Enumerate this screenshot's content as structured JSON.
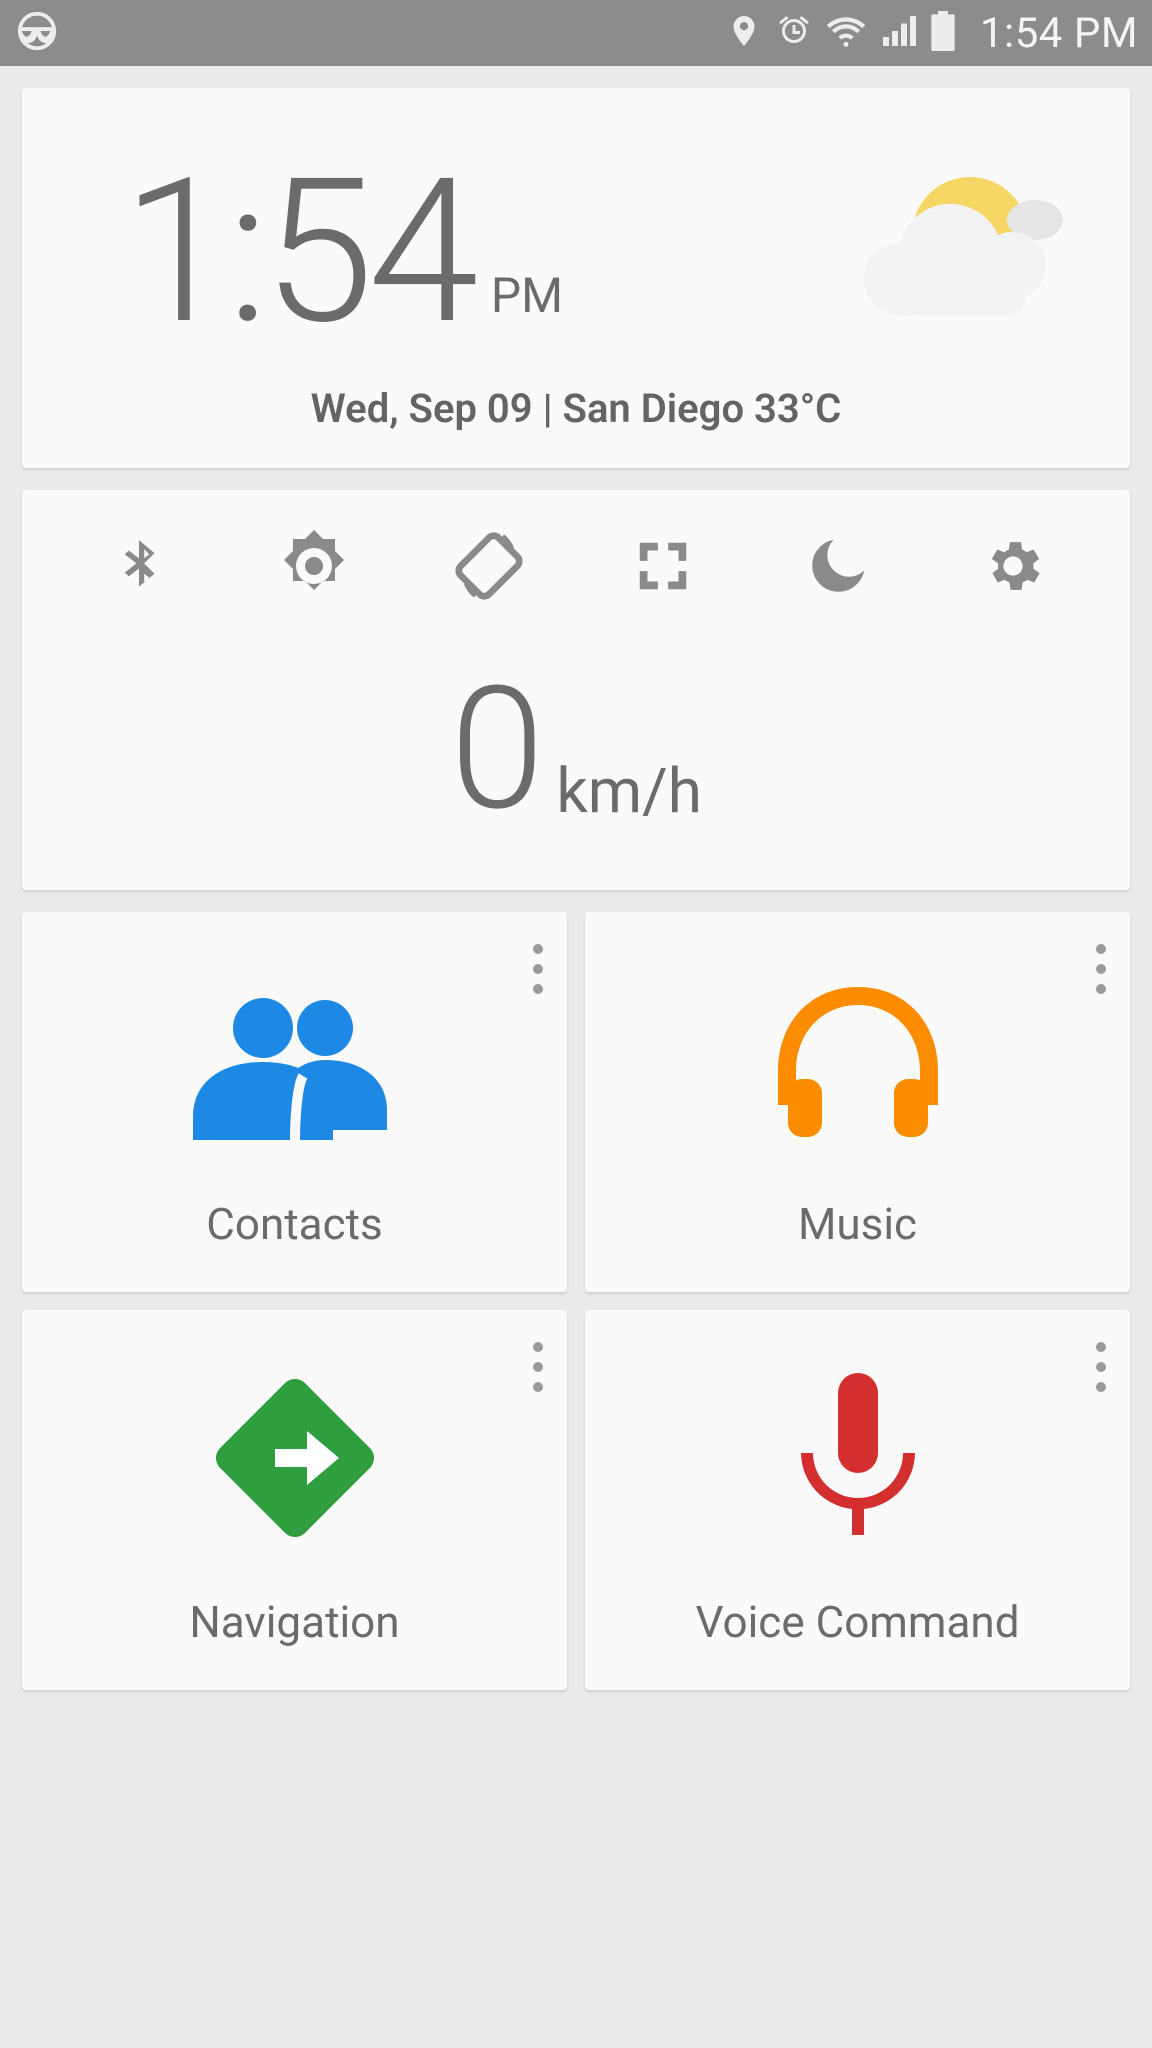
{
  "status_bar": {
    "time": "1:54 PM"
  },
  "clock": {
    "time": "1:54",
    "ampm": "PM",
    "date_line": "Wed, Sep 09 | San Diego 33°C"
  },
  "speed": {
    "value": "0",
    "unit": "km/h"
  },
  "toggles": [
    {
      "name": "bluetooth-icon"
    },
    {
      "name": "brightness-icon"
    },
    {
      "name": "rotate-icon"
    },
    {
      "name": "fullscreen-icon"
    },
    {
      "name": "night-icon"
    },
    {
      "name": "settings-icon"
    }
  ],
  "tiles": [
    {
      "label": "Contacts",
      "name": "contacts-tile",
      "icon": "contacts-icon",
      "color": "#1e88e5"
    },
    {
      "label": "Music",
      "name": "music-tile",
      "icon": "headphones-icon",
      "color": "#fb8c00"
    },
    {
      "label": "Navigation",
      "name": "navigation-tile",
      "icon": "navigate-icon",
      "color": "#2e9e3f"
    },
    {
      "label": "Voice Command",
      "name": "voice-command-tile",
      "icon": "mic-icon",
      "color": "#d32f2f"
    }
  ]
}
